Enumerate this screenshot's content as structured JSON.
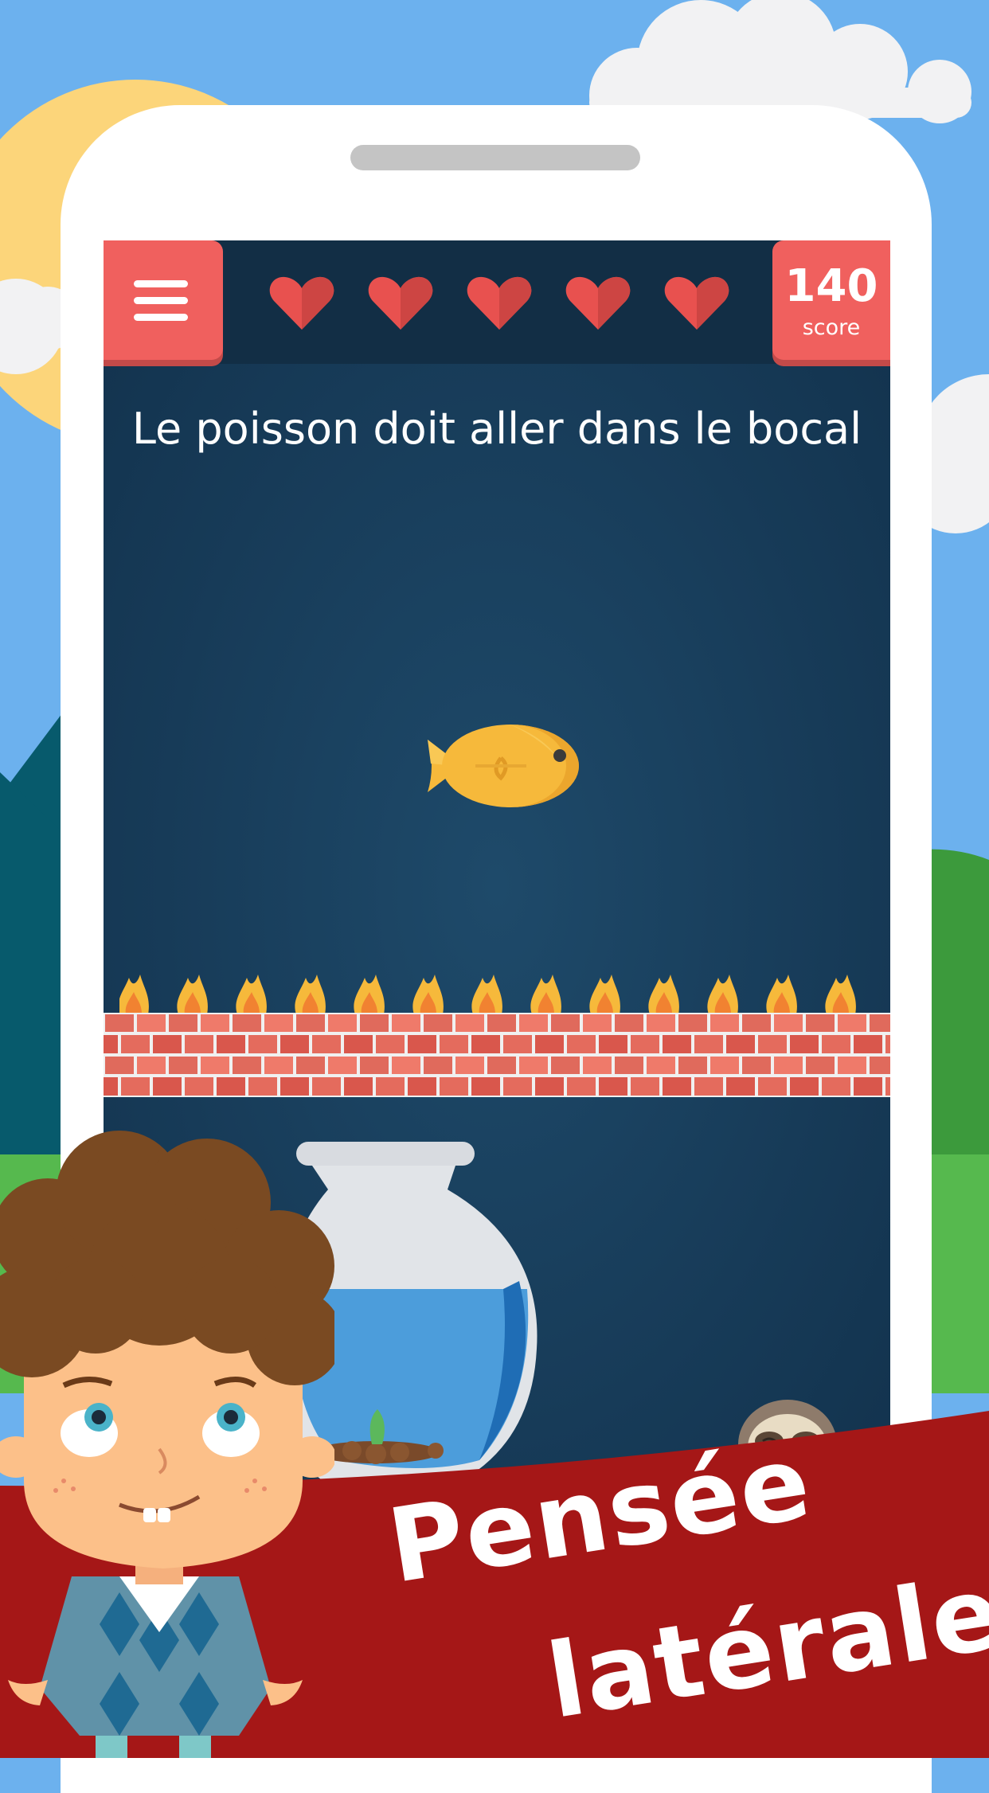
{
  "hud": {
    "menu_icon": "hamburger-menu-icon",
    "lives_total": 5,
    "lives_remaining": 5,
    "heart_color": "#e8514f",
    "score_value": "140",
    "score_label": "score"
  },
  "level": {
    "prompt": "Le poisson doit aller dans le bocal",
    "fish_color": "#f6b93b"
  },
  "promo": {
    "tagline_line1": "Pensée",
    "tagline_line2": "latérale!",
    "banner_color": "#a51717"
  },
  "colors": {
    "sky": "#6cb1ee",
    "screen_bg": "#173b58",
    "accent": "#f0605e"
  }
}
